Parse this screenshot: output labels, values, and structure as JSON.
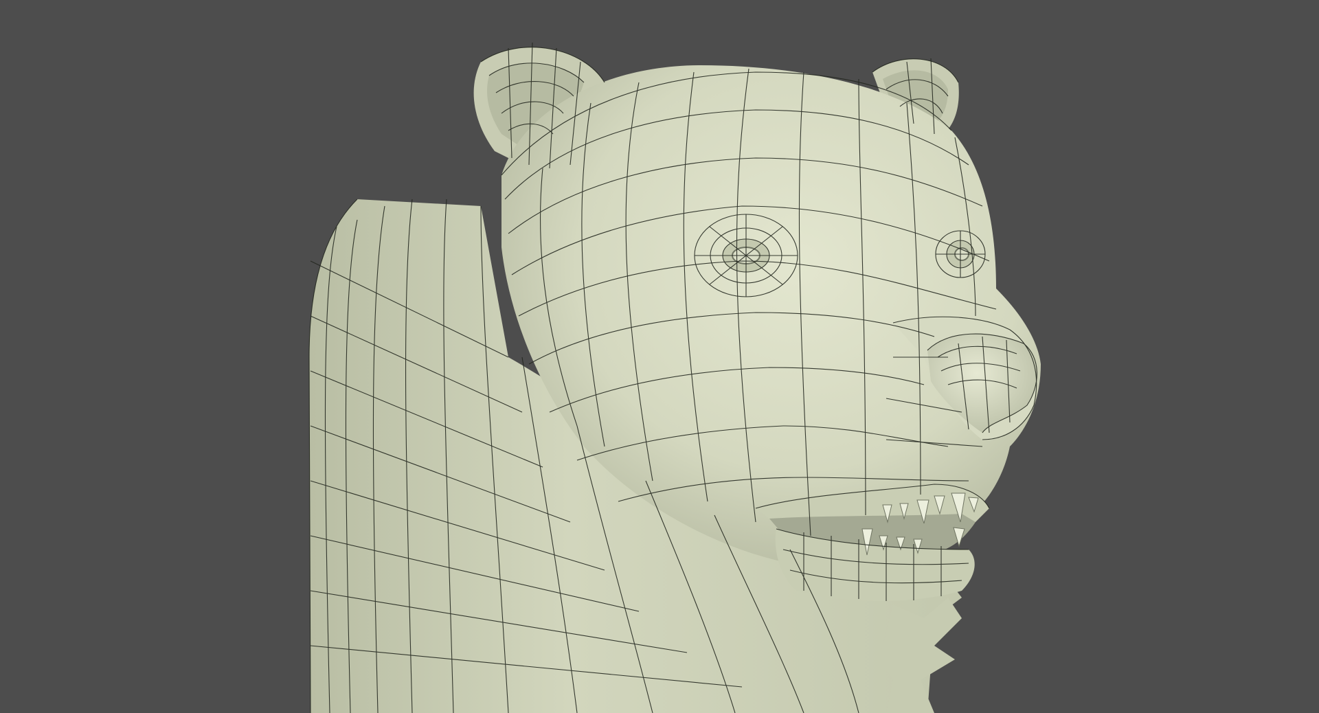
{
  "viewport": {
    "background_color": "#4d4d4d",
    "mesh_base_color": "#d8dcc4",
    "mesh_shadow_color": "#aeb39a",
    "wire_color": "#1f221c"
  },
  "model": {
    "icon": "bear-head-mesh",
    "display_mode": "solid-with-wireframe"
  }
}
